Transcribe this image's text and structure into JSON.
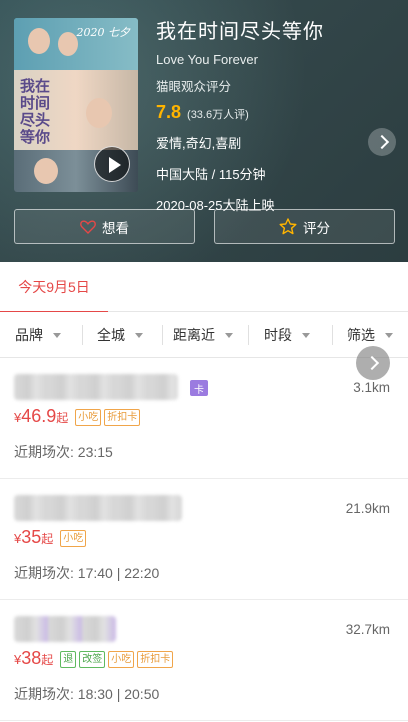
{
  "movie": {
    "title": "我在时间尽头等你",
    "en_title": "Love You Forever",
    "score_label": "猫眼观众评分",
    "score": "7.8",
    "score_count": "(33.6万人评)",
    "genre": "爱情,奇幻,喜剧",
    "region_duration": "中国大陆 / 115分钟",
    "release": "2020-08-25大陆上映",
    "poster_text_1": "2020 七夕情书",
    "poster_text_2": "我在时间尽头等你"
  },
  "actions": {
    "want_label": "想看",
    "rate_label": "评分"
  },
  "date_tab": "今天9月5日",
  "filters": [
    "品牌",
    "全城",
    "距离近",
    "时段",
    "筛选"
  ],
  "cinemas": [
    {
      "card_tag": "卡",
      "distance": "3.1km",
      "yen": "¥",
      "price": "46.9",
      "price_suffix": "起",
      "tags": [
        "小吃",
        "折扣卡"
      ],
      "shows": "近期场次: 23:15"
    },
    {
      "distance": "21.9km",
      "yen": "¥",
      "price": "35",
      "price_suffix": "起",
      "tags": [
        "小吃"
      ],
      "shows": "近期场次: 17:40 | 22:20"
    },
    {
      "distance": "32.7km",
      "yen": "¥",
      "price": "38",
      "price_suffix": "起",
      "tags": [
        "退",
        "改签",
        "小吃",
        "折扣卡"
      ],
      "shows": "近期场次: 18:30 | 20:50"
    }
  ],
  "colors": {
    "accent": "#e54847",
    "score": "#ffb400",
    "tag_orange": "#e89b3a",
    "tag_green": "#4aa64a",
    "card_purple": "#9b7be0"
  }
}
